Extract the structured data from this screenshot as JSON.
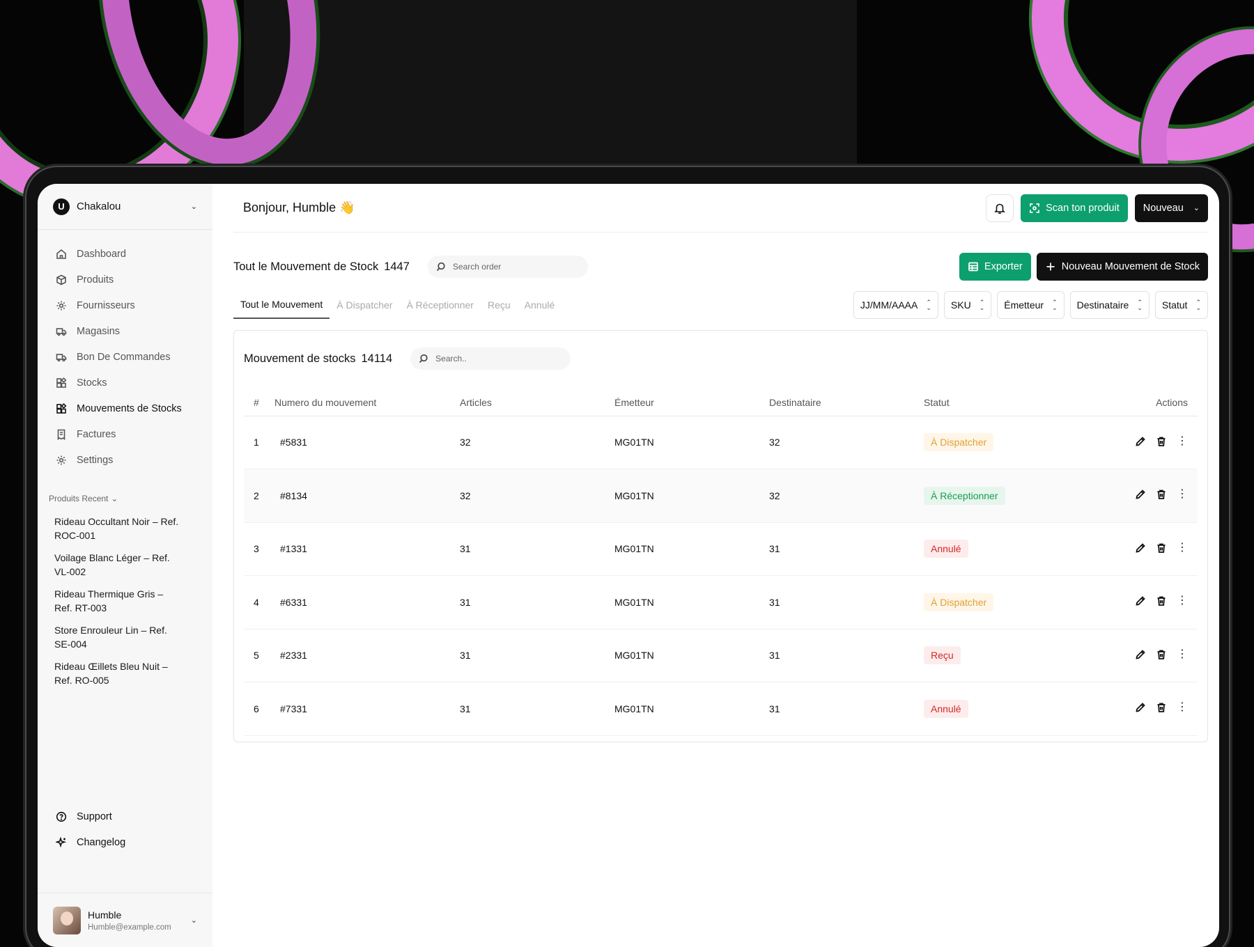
{
  "workspace": {
    "name": "Chakalou"
  },
  "sidebar": {
    "items": [
      {
        "label": "Dashboard",
        "icon": "home-icon"
      },
      {
        "label": "Produits",
        "icon": "box-icon"
      },
      {
        "label": "Fournisseurs",
        "icon": "gear-icon"
      },
      {
        "label": "Magasins",
        "icon": "truck-icon"
      },
      {
        "label": "Bon De Commandes",
        "icon": "truck-icon"
      },
      {
        "label": "Stocks",
        "icon": "grid-icon"
      },
      {
        "label": "Mouvements de Stocks",
        "icon": "grid-icon"
      },
      {
        "label": "Factures",
        "icon": "receipt-icon"
      },
      {
        "label": "Settings",
        "icon": "gear-icon"
      }
    ],
    "recent_title": "Produits Recent",
    "recent": [
      "Rideau Occultant Noir – Ref. ROC-001",
      "Voilage Blanc Léger – Ref. VL-002",
      "Rideau Thermique Gris – Ref. RT-003",
      "Store Enrouleur Lin – Ref. SE-004",
      "Rideau Œillets Bleu Nuit – Ref. RO-005"
    ],
    "bottom": [
      {
        "label": "Support",
        "icon": "help-icon"
      },
      {
        "label": "Changelog",
        "icon": "sparkle-icon"
      }
    ],
    "profile": {
      "name": "Humble",
      "email": "Humble@example.com"
    }
  },
  "header": {
    "greeting": "Bonjour, Humble",
    "wave": "👋",
    "scan_label": "Scan ton produit",
    "nouveau_label": "Nouveau"
  },
  "section": {
    "title": "Tout le Mouvement de Stock",
    "count": "1447",
    "search_placeholder": "Search order",
    "export_label": "Exporter",
    "new_label": "Nouveau Mouvement de Stock"
  },
  "tabs": [
    "Tout le Mouvement",
    "À Dispatcher",
    "À Réceptionner",
    "Reçu",
    "Annulé"
  ],
  "filters": [
    "JJ/MM/AAAA",
    "SKU",
    "Émetteur",
    "Destinataire",
    "Statut"
  ],
  "card": {
    "title": "Mouvement de stocks",
    "count": "14114",
    "search_placeholder": "Search.."
  },
  "table": {
    "headers": [
      "#",
      "Numero du mouvement",
      "Articles",
      "Émetteur",
      "Destinataire",
      "Statut",
      "Actions"
    ],
    "rows": [
      {
        "n": "1",
        "num": "#5831",
        "articles": "32",
        "emetteur": "MG01TN",
        "dest": "32",
        "statut": "À Dispatcher",
        "kind": "dispatch"
      },
      {
        "n": "2",
        "num": "#8134",
        "articles": "32",
        "emetteur": "MG01TN",
        "dest": "32",
        "statut": "À Réceptionner",
        "kind": "recept"
      },
      {
        "n": "3",
        "num": "#1331",
        "articles": "31",
        "emetteur": "MG01TN",
        "dest": "31",
        "statut": "Annulé",
        "kind": "annule"
      },
      {
        "n": "4",
        "num": "#6331",
        "articles": "31",
        "emetteur": "MG01TN",
        "dest": "31",
        "statut": "À Dispatcher",
        "kind": "dispatch"
      },
      {
        "n": "5",
        "num": "#2331",
        "articles": "31",
        "emetteur": "MG01TN",
        "dest": "31",
        "statut": "Reçu",
        "kind": "recu"
      },
      {
        "n": "6",
        "num": "#7331",
        "articles": "31",
        "emetteur": "MG01TN",
        "dest": "31",
        "statut": "Annulé",
        "kind": "annule"
      }
    ]
  },
  "colors": {
    "accent_green": "#0d9f6e",
    "dark": "#111111",
    "dispatch": "#e0a038",
    "recept": "#1c9a55",
    "annule": "#d12a2a"
  }
}
